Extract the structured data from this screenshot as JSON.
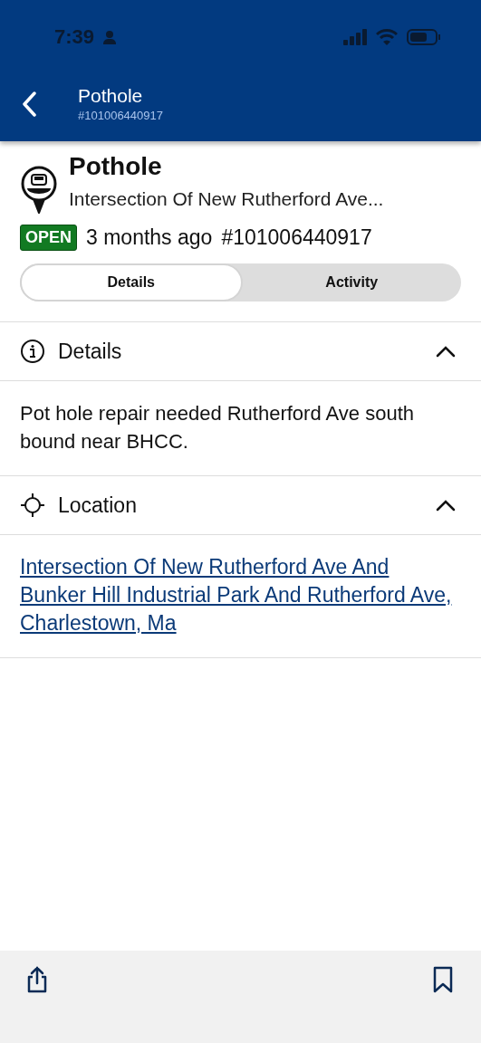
{
  "status_bar": {
    "time": "7:39"
  },
  "nav": {
    "title": "Pothole",
    "subtitle": "#101006440917"
  },
  "request": {
    "title": "Pothole",
    "address": "Intersection Of New Rutherford Ave...",
    "status": "OPEN",
    "age": "3 months ago",
    "number": "#101006440917"
  },
  "tabs": [
    {
      "label": "Details",
      "selected": true
    },
    {
      "label": "Activity",
      "selected": false
    }
  ],
  "sections": [
    {
      "kind": "info",
      "title": "Details",
      "expanded": true,
      "body": {
        "kind": "text",
        "text": "Pot hole repair needed Rutherford Ave south bound near BHCC."
      }
    },
    {
      "kind": "location",
      "title": "Location",
      "expanded": true,
      "body": {
        "kind": "link",
        "text": "Intersection Of New Rutherford Ave And Bunker Hill Industrial Park And Rutherford Ave, Charlestown, Ma"
      }
    }
  ]
}
